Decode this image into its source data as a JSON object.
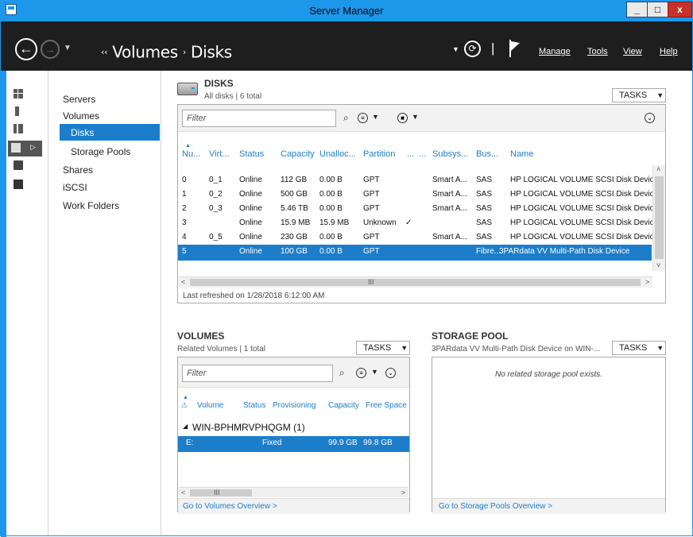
{
  "window": {
    "title": "Server Manager"
  },
  "window_controls": {
    "minimize": "_",
    "maximize": "□",
    "close": "x"
  },
  "nav": {
    "breadcrumb": [
      "Volumes",
      "Disks"
    ],
    "breadcrumb_prefix": "‹‹",
    "breadcrumb_sep": "›",
    "pipe": "|",
    "menus": [
      "Manage",
      "Tools",
      "View",
      "Help"
    ]
  },
  "sidebar": {
    "icons": [
      "dashboard-icon",
      "local-server-icon",
      "all-servers-icon",
      "file-storage-icon",
      "file-storage-sub-icon",
      "print-icon"
    ],
    "items": [
      {
        "label": "Servers"
      },
      {
        "label": "Volumes"
      },
      {
        "label": "Disks"
      },
      {
        "label": "Storage Pools"
      },
      {
        "label": "Shares"
      },
      {
        "label": "iSCSI"
      },
      {
        "label": "Work Folders"
      }
    ]
  },
  "disks": {
    "title": "DISKS",
    "subtitle": "All disks | 6 total",
    "tasks_label": "TASKS",
    "filter_placeholder": "Filter",
    "columns": [
      "Nu...",
      "Virt...",
      "Status",
      "Capacity",
      "Unalloc...",
      "Partition",
      "...",
      "...",
      "Subsys...",
      "Bus...",
      "Name"
    ],
    "rows": [
      {
        "num": "0",
        "virt": "0_1",
        "status": "Online",
        "capacity": "112 GB",
        "unalloc": "0.00 B",
        "partition": "GPT",
        "check": "",
        "subsys": "Smart A...",
        "bus": "SAS",
        "name": "HP LOGICAL VOLUME SCSI Disk Device"
      },
      {
        "num": "1",
        "virt": "0_2",
        "status": "Online",
        "capacity": "500 GB",
        "unalloc": "0.00 B",
        "partition": "GPT",
        "check": "",
        "subsys": "Smart A...",
        "bus": "SAS",
        "name": "HP LOGICAL VOLUME SCSI Disk Device"
      },
      {
        "num": "2",
        "virt": "0_3",
        "status": "Online",
        "capacity": "5.46 TB",
        "unalloc": "0.00 B",
        "partition": "GPT",
        "check": "",
        "subsys": "Smart A...",
        "bus": "SAS",
        "name": "HP LOGICAL VOLUME SCSI Disk Device"
      },
      {
        "num": "3",
        "virt": "",
        "status": "Online",
        "capacity": "15.9 MB",
        "unalloc": "15.9 MB",
        "partition": "Unknown",
        "check": "✓",
        "subsys": "",
        "bus": "SAS",
        "name": "HP LOGICAL VOLUME SCSI Disk Device"
      },
      {
        "num": "4",
        "virt": "0_5",
        "status": "Online",
        "capacity": "230 GB",
        "unalloc": "0.00 B",
        "partition": "GPT",
        "check": "",
        "subsys": "Smart A...",
        "bus": "SAS",
        "name": "HP LOGICAL VOLUME SCSI Disk Device"
      },
      {
        "num": "5",
        "virt": "",
        "status": "Online",
        "capacity": "100 GB",
        "unalloc": "0.00 B",
        "partition": "GPT",
        "check": "",
        "subsys": "",
        "bus": "Fibre...",
        "name": "3PARdata VV  Multi-Path Disk Device"
      }
    ],
    "scroll_grip": "III",
    "refreshed": "Last refreshed on 1/28/2018 6:12:00 AM"
  },
  "volumes": {
    "title": "VOLUMES",
    "subtitle": "Related Volumes | 1 total",
    "tasks_label": "TASKS",
    "filter_placeholder": "Filter",
    "columns": [
      "Volume",
      "Status",
      "Provisioning",
      "Capacity",
      "Free Space"
    ],
    "group": "WIN-BPHMRVPHQGM (1)",
    "rows": [
      {
        "volume": "E:",
        "provisioning": "Fixed",
        "capacity": "99.9 GB",
        "free": "99.8 GB"
      }
    ],
    "scroll_grip": "III",
    "link": "Go to Volumes Overview >"
  },
  "storage_pool": {
    "title": "STORAGE POOL",
    "subtitle": "3PARdata VV  Multi-Path Disk Device on WIN-...",
    "tasks_label": "TASKS",
    "empty": "No related storage pool exists.",
    "link": "Go to Storage Pools Overview >"
  },
  "colors": {
    "accent": "#1c97ea",
    "selection": "#1c7ecb",
    "navbar": "#1e1e1e"
  }
}
